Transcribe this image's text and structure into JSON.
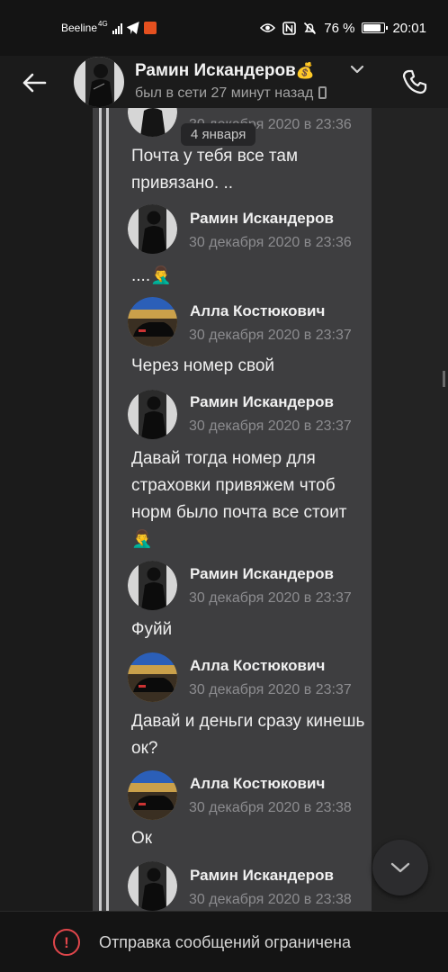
{
  "status_bar": {
    "carrier": "Beeline",
    "network": "4G",
    "battery_text": "76 %",
    "battery_level": 0.76,
    "time": "20:01",
    "icons": [
      "signal-icon",
      "telegram-icon",
      "app-icon",
      "eye-icon",
      "nfc-icon",
      "mute-icon",
      "battery-icon"
    ]
  },
  "header": {
    "name": "Рамин Искандеров",
    "name_emoji": "💰",
    "status": "был в сети 27 минут назад",
    "icons": [
      "back-arrow-icon",
      "chevron-down-icon",
      "mobile-icon",
      "phone-call-icon"
    ]
  },
  "date_chip": "4 января",
  "partial_time": "30 декабря 2020 в 23:36",
  "messages": [
    {
      "kind": "continuation",
      "text": "Почта у тебя все там привязано. .."
    },
    {
      "kind": "header",
      "sender": "Рамин Искандеров",
      "time": "30 декабря 2020 в 23:36",
      "avatar": "ramin"
    },
    {
      "kind": "continuation",
      "text": "....🤦‍♂️"
    },
    {
      "kind": "header",
      "sender": "Алла Костюкович",
      "time": "30 декабря 2020 в 23:37",
      "avatar": "alla"
    },
    {
      "kind": "continuation",
      "text": "Через номер свой"
    },
    {
      "kind": "header",
      "sender": "Рамин Искандеров",
      "time": "30 декабря 2020 в 23:37",
      "avatar": "ramin"
    },
    {
      "kind": "continuation",
      "text": "Давай тогда номер для страховки привяжем чтоб норм было почта все стоит 🤦‍♂️"
    },
    {
      "kind": "header",
      "sender": "Рамин Искандеров",
      "time": "30 декабря 2020 в 23:37",
      "avatar": "ramin"
    },
    {
      "kind": "continuation",
      "text": "Фуйй"
    },
    {
      "kind": "header",
      "sender": "Алла Костюкович",
      "time": "30 декабря 2020 в 23:37",
      "avatar": "alla"
    },
    {
      "kind": "continuation",
      "text": "Давай и деньги сразу кинешь ок?"
    },
    {
      "kind": "header",
      "sender": "Алла Костюкович",
      "time": "30 декабря 2020 в 23:38",
      "avatar": "alla"
    },
    {
      "kind": "continuation",
      "text": "Ок"
    },
    {
      "kind": "header",
      "sender": "Рамин Искандеров",
      "time": "30 декабря 2020 в 23:38",
      "avatar": "ramin"
    }
  ],
  "bottom_bar": {
    "text": "Отправка сообщений ограничена",
    "icon": "error-icon"
  },
  "colors": {
    "background": "#1b1b1b",
    "chat_background": "#3e3e40",
    "rail": "#c9c9cb",
    "restriction_red": "#e0464b"
  }
}
